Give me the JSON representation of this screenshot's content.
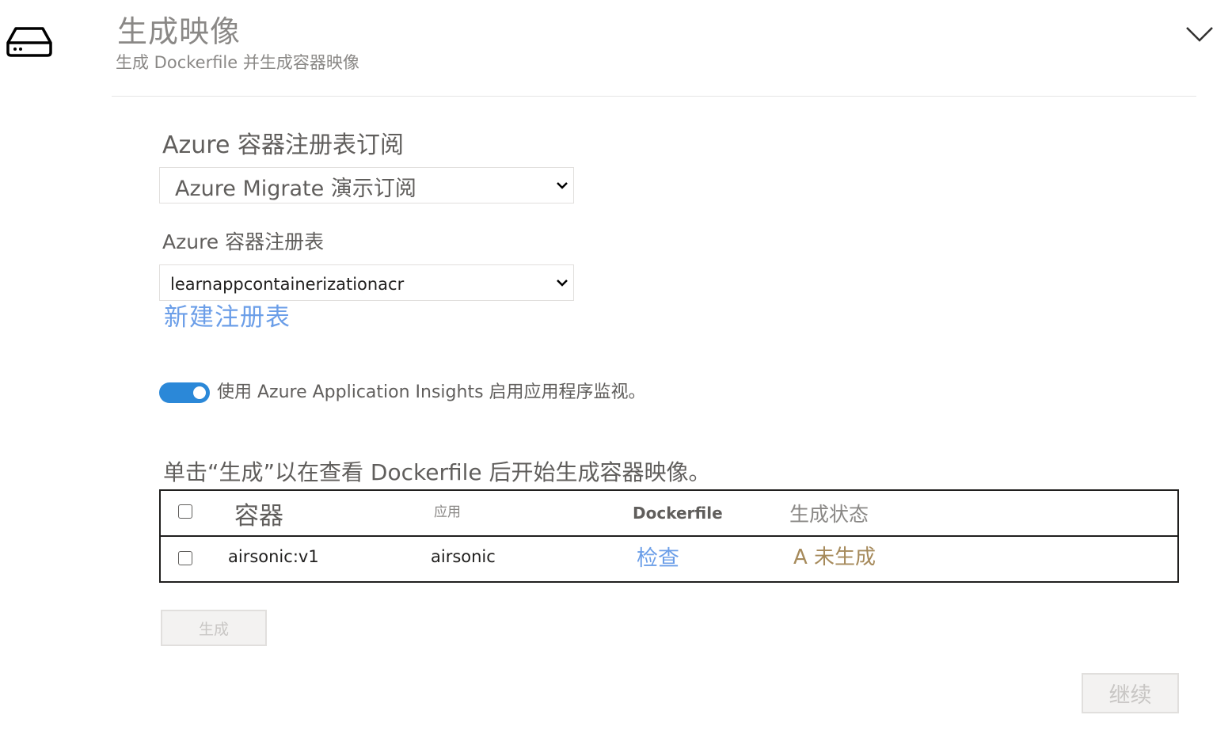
{
  "header": {
    "icon": "server-drive-icon",
    "title": "生成映像",
    "subtitle": "生成 Dockerfile 并生成容器映像",
    "collapse_icon": "chevron-down-icon"
  },
  "form": {
    "subscription": {
      "label": "Azure 容器注册表订阅",
      "selected": "Azure  Migrate 演示订阅"
    },
    "registry": {
      "label": "Azure 容器注册表",
      "selected": "learnappcontainerizationacr"
    },
    "new_registry_link": "新建注册表",
    "insights": {
      "enabled": true,
      "label": "使用 Azure Application Insights 启用应用程序监视。"
    }
  },
  "instruction": "单击“生成”以在查看 Dockerfile 后开始生成容器映像。",
  "table": {
    "columns": [
      "容器",
      "应用",
      "Dockerfile",
      "生成状态"
    ],
    "rows": [
      {
        "checked": false,
        "container": "airsonic:v1",
        "app": "airsonic",
        "dockerfile": "检查",
        "status": "A 未生成"
      }
    ]
  },
  "buttons": {
    "build": "生成",
    "continue": "继续"
  },
  "colors": {
    "accent": "#2b88d8",
    "link": "#6b9ee8",
    "status_not_built": "#a68a5b",
    "muted_text": "#8a8886"
  }
}
